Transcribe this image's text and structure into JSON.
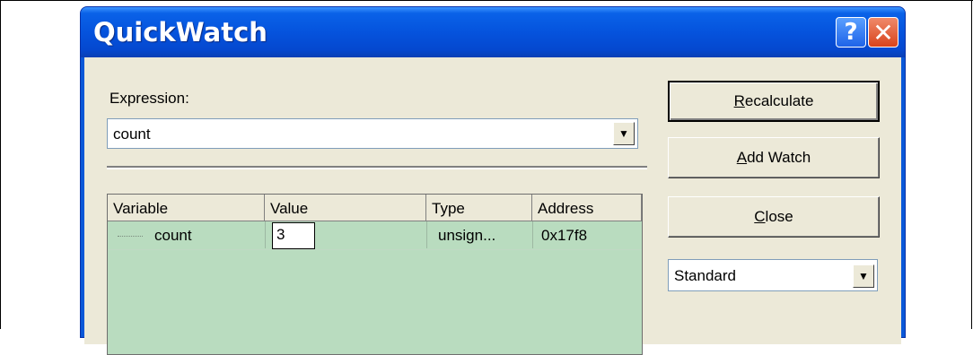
{
  "dialog": {
    "title": "QuickWatch",
    "help_glyph": "?",
    "close_glyph": "✕"
  },
  "expression": {
    "label": "Expression:",
    "value": "count"
  },
  "table": {
    "headers": [
      "Variable",
      "Value",
      "Type",
      "Address"
    ],
    "rows": [
      {
        "variable": "count",
        "value": "3",
        "type": "unsign...",
        "address": "0x17f8"
      }
    ]
  },
  "buttons": {
    "recalculate": "Recalculate",
    "add_watch": "Add Watch",
    "close": "Close"
  },
  "format_select": {
    "value": "Standard"
  },
  "icons": {
    "dropdown": "chevron-down-icon",
    "help": "help-icon",
    "close": "close-icon"
  }
}
